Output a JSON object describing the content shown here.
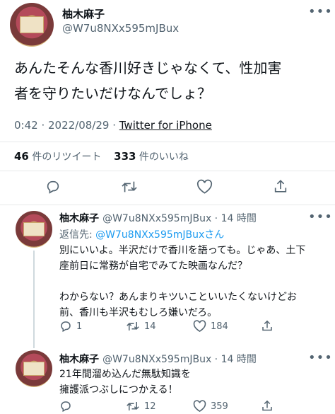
{
  "main_tweet": {
    "author_name": "柚木麻子",
    "author_handle": "@W7u8NXx595mJBux",
    "text_line1": "あんたそんな香川好きじゃなくて、性加害",
    "text_line2": "者を守りたいだけなんでしょ？",
    "timestamp": "0:42 · 2022/08/29 · ",
    "source": "Twitter for iPhone",
    "retweets_count": "46",
    "retweets_label": "件のリツイート",
    "likes_count": "333",
    "likes_label": "件のいいね"
  },
  "replies": [
    {
      "author_name": "柚木麻子",
      "author_handle": "@W7u8NXx595mJBux · 14 時間",
      "reply_to_prefix": "返信先: ",
      "reply_to_handle": "@W7u8NXx595mJBuxさん",
      "lines": [
        "別にいいよ。半沢だけで香川を語っても。じゃあ、土下",
        "座前日に常務が自宅でみてた映画なんだ？",
        "",
        "わからない？あんまりキツいこといいたくないけどお",
        "前、香川も半沢もむしろ嫌いだろ。"
      ],
      "reply_count": "1",
      "retweet_count": "14",
      "like_count": "184"
    },
    {
      "author_name": "柚木麻子",
      "author_handle": "@W7u8NXx595mJBux · 14 時間",
      "lines": [
        "21年間溜め込んだ無駄知識を",
        "擁護派つぶしにつかえる！"
      ],
      "reply_count": "",
      "retweet_count": "12",
      "like_count": "359"
    }
  ],
  "icons": [
    "more-icon",
    "reply-icon",
    "retweet-icon",
    "like-icon",
    "share-icon"
  ],
  "colors": {
    "link": "#1d9bf0",
    "muted": "#536471",
    "text": "#0f1419",
    "border": "#e7e9ea"
  }
}
